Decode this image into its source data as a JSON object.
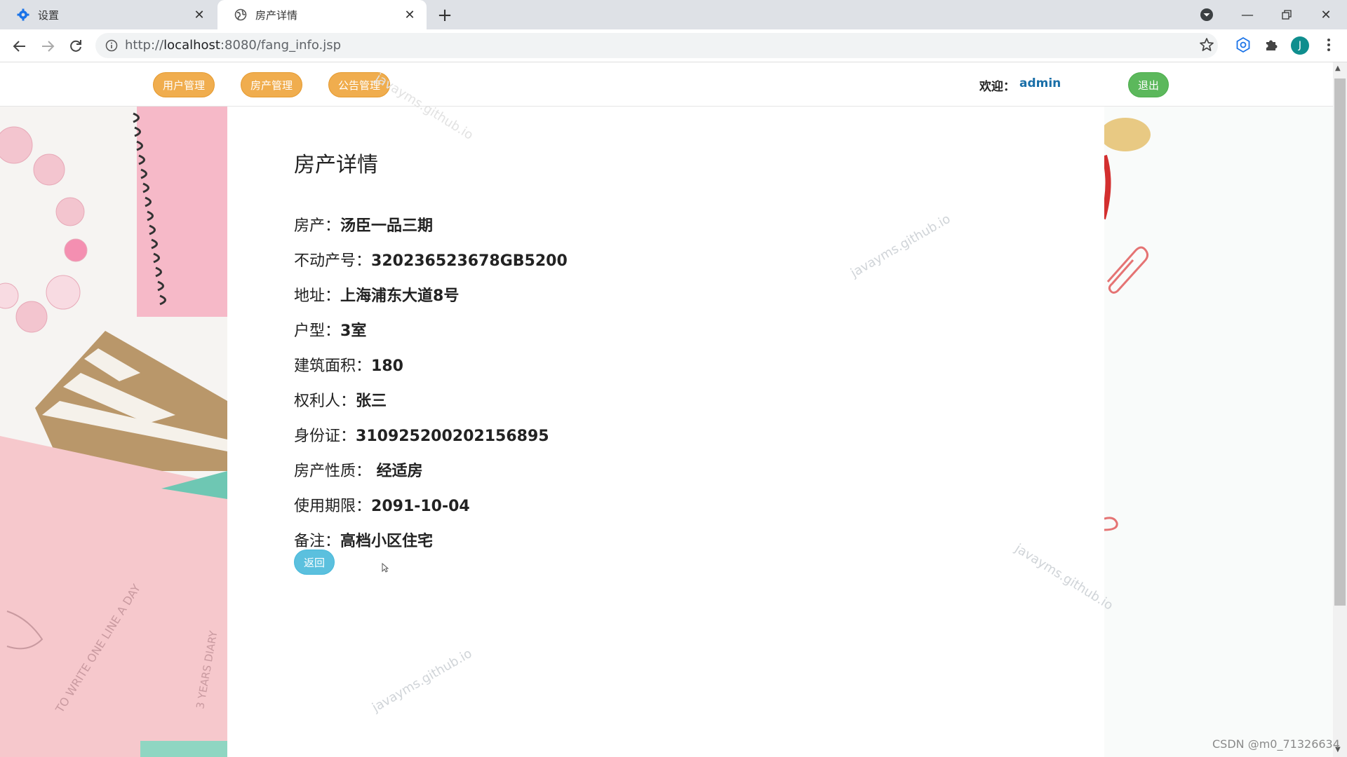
{
  "browser": {
    "tabs": [
      {
        "title": "设置",
        "icon": "gear-icon"
      },
      {
        "title": "房产详情",
        "icon": "globe-icon"
      }
    ],
    "new_tab": "+",
    "url_prefix": "http://",
    "url_host": "localhost",
    "url_path": ":8080/fang_info.jsp",
    "profile_initial": "J"
  },
  "nav": {
    "items": [
      "用户管理",
      "房产管理",
      "公告管理"
    ],
    "welcome_label": "欢迎：",
    "username": "admin",
    "logout_label": "退出"
  },
  "detail": {
    "title": "房产详情",
    "fields": [
      {
        "label": "房产：",
        "value": "汤臣一品三期"
      },
      {
        "label": "不动产号：",
        "value": "320236523678GB5200"
      },
      {
        "label": "地址：",
        "value": "上海浦东大道8号"
      },
      {
        "label": "户型：",
        "value": "3室"
      },
      {
        "label": "建筑面积：",
        "value": "180"
      },
      {
        "label": "权利人：",
        "value": "张三"
      },
      {
        "label": "身份证：",
        "value": "310925200202156895"
      },
      {
        "label": "房产性质：",
        "value": " 经适房"
      },
      {
        "label": "使用期限：",
        "value": "2091-10-04"
      },
      {
        "label": "备注：",
        "value": "高档小区住宅"
      }
    ],
    "back_label": "返回"
  },
  "watermarks": [
    "javayms.github.io",
    "javayms.github.io",
    "javayms.github.io",
    "javayms.github.io"
  ],
  "decor_text": {
    "circle_text": "TO WRITE ONE LINE A DAY",
    "diary_text": "3 YEARS DIARY"
  },
  "footer_credit": "CSDN @m0_71326634",
  "colors": {
    "nav_button": "#f0ad4e",
    "logout_button": "#5cb85c",
    "back_button": "#5bc0de",
    "username": "#1a6fa8"
  }
}
